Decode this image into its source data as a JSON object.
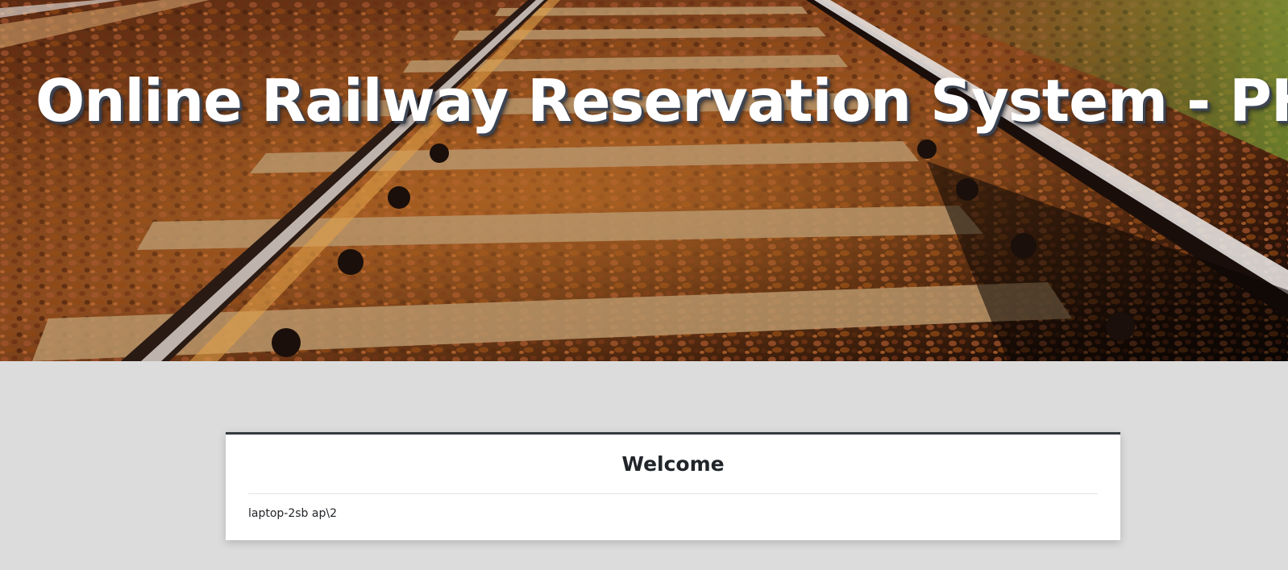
{
  "hero": {
    "title": "Online Railway Reservation System - PHP",
    "colors": {
      "ballast": "#7a3a18",
      "rail": "#d9d4d0",
      "sleeper": "#b89a6a",
      "shadow": "#120805"
    }
  },
  "welcome_card": {
    "title": "Welcome",
    "user": "laptop-2sb    ap\\2"
  }
}
